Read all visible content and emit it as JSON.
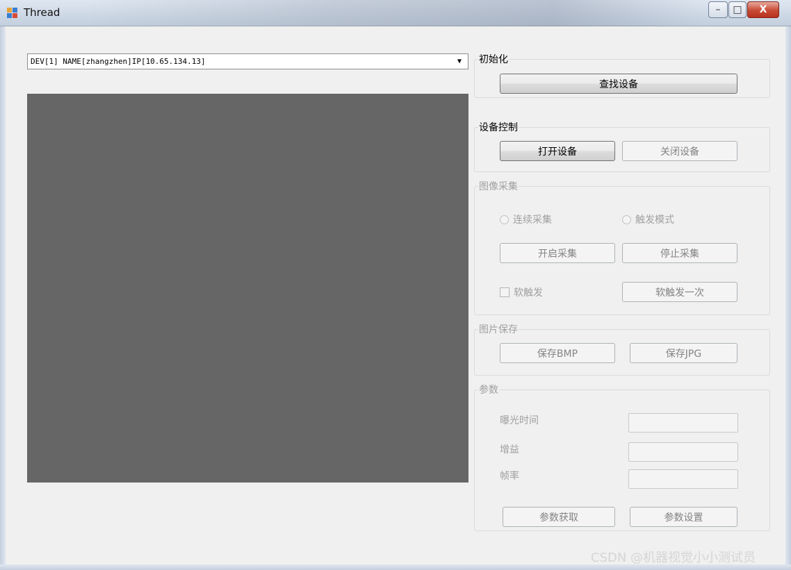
{
  "window": {
    "title": "Thread",
    "minimize_glyph": "–",
    "maximize_glyph": "□",
    "close_glyph": "X"
  },
  "device_select": {
    "value": "DEV[1] NAME[zhangzhen]IP[10.65.134.13]",
    "arrow_glyph": "▼"
  },
  "init_group": {
    "title": "初始化",
    "find_button": "查找设备"
  },
  "control_group": {
    "title": "设备控制",
    "open_button": "打开设备",
    "close_button": "关闭设备"
  },
  "capture_group": {
    "title": "图像采集",
    "radio_continuous": "连续采集",
    "radio_trigger": "触发模式",
    "start_button": "开启采集",
    "stop_button": "停止采集",
    "soft_trigger_check": "软触发",
    "soft_trigger_once_button": "软触发一次"
  },
  "save_group": {
    "title": "图片保存",
    "save_bmp_button": "保存BMP",
    "save_jpg_button": "保存JPG"
  },
  "params_group": {
    "title": "参数",
    "exposure_label": "曝光时间",
    "gain_label": "增益",
    "framerate_label": "帧率",
    "exposure_value": "",
    "gain_value": "",
    "framerate_value": "",
    "get_button": "参数获取",
    "set_button": "参数设置"
  },
  "watermark": "CSDN @机器视觉小小测试员"
}
